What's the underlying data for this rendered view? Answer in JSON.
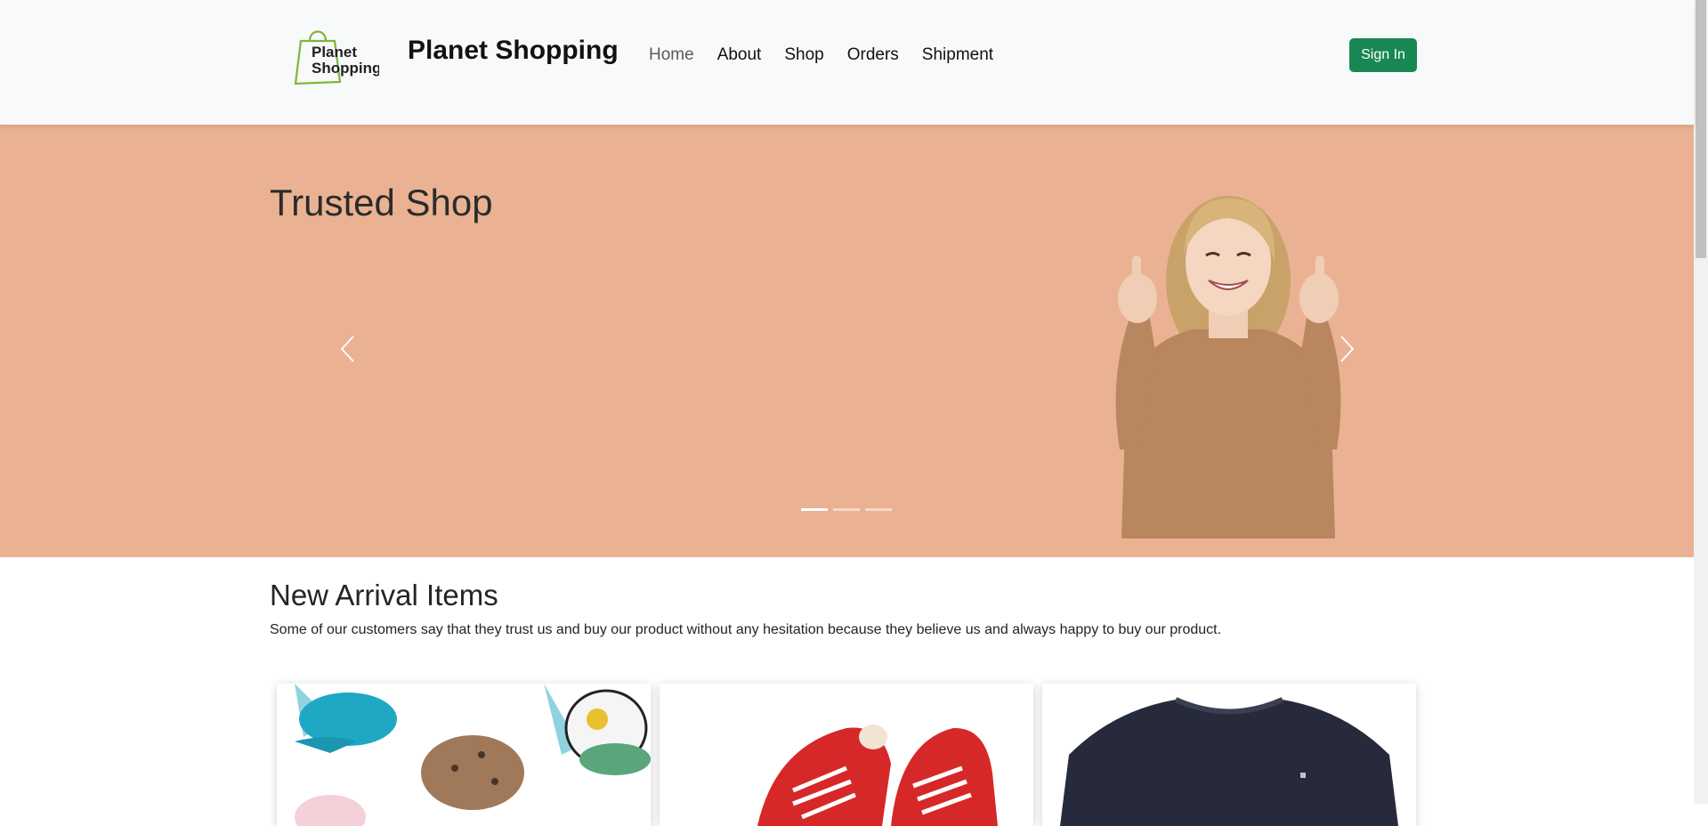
{
  "navbar": {
    "brand": "Planet Shopping",
    "logo_text_top": "Planet",
    "logo_text_bottom": "Shopping",
    "links": [
      {
        "label": "Home",
        "active": true
      },
      {
        "label": "About"
      },
      {
        "label": "Shop"
      },
      {
        "label": "Orders"
      },
      {
        "label": "Shipment"
      }
    ],
    "signin_label": "Sign In"
  },
  "hero": {
    "title": "Trusted Shop",
    "bg_color": "#eab293",
    "prev_icon": "chevron-left-icon",
    "next_icon": "chevron-right-icon",
    "slides": 3,
    "active_slide": 1
  },
  "arrivals": {
    "title": "New Arrival Items",
    "description": "Some of our customers say that they trust us and buy our product without any hesitation because they believe us and always happy to buy our product."
  },
  "colors": {
    "accent": "#198754",
    "navbar_bg": "#f8f9fa"
  }
}
